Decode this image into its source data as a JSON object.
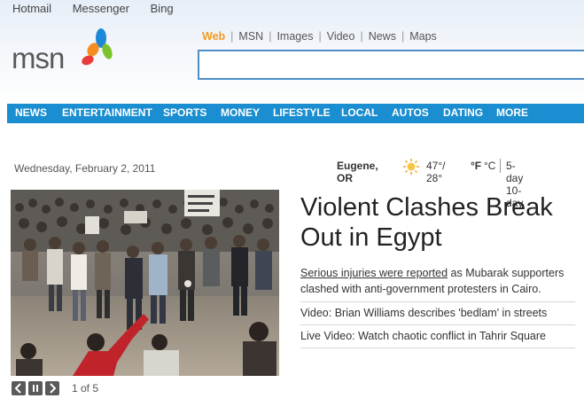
{
  "top_links": [
    "Hotmail",
    "Messenger",
    "Bing"
  ],
  "logo": {
    "text": "msn"
  },
  "search": {
    "tabs": [
      "Web",
      "MSN",
      "Images",
      "Video",
      "News",
      "Maps"
    ],
    "active_tab": "Web",
    "value": "",
    "placeholder": ""
  },
  "nav": [
    "NEWS",
    "ENTERTAINMENT",
    "SPORTS",
    "MONEY",
    "LIFESTYLE",
    "LOCAL",
    "AUTOS",
    "DATING",
    "MORE"
  ],
  "date": "Wednesday, February 2, 2011",
  "weather": {
    "location": "Eugene, OR",
    "temps": "47°/ 28°",
    "unit_f": "°F",
    "unit_c": "°C",
    "forecast_link": "5-day 10-day",
    "icon": "sun-icon"
  },
  "story": {
    "headline": "Violent Clashes Break Out in Egypt",
    "summary_link": "Serious injuries were reported",
    "summary_rest": " as Mubarak supporters clashed with anti-government protesters in Cairo.",
    "sub_links": [
      "Video: Brian Williams describes 'bedlam' in streets",
      "Live Video: Watch chaotic conflict in Tahrir Square"
    ]
  },
  "slideshow": {
    "counter": "1 of 5"
  },
  "colors": {
    "nav_bg": "#1a8ed0",
    "search_border": "#4d8ec6",
    "active_tab": "#f39a1d"
  }
}
